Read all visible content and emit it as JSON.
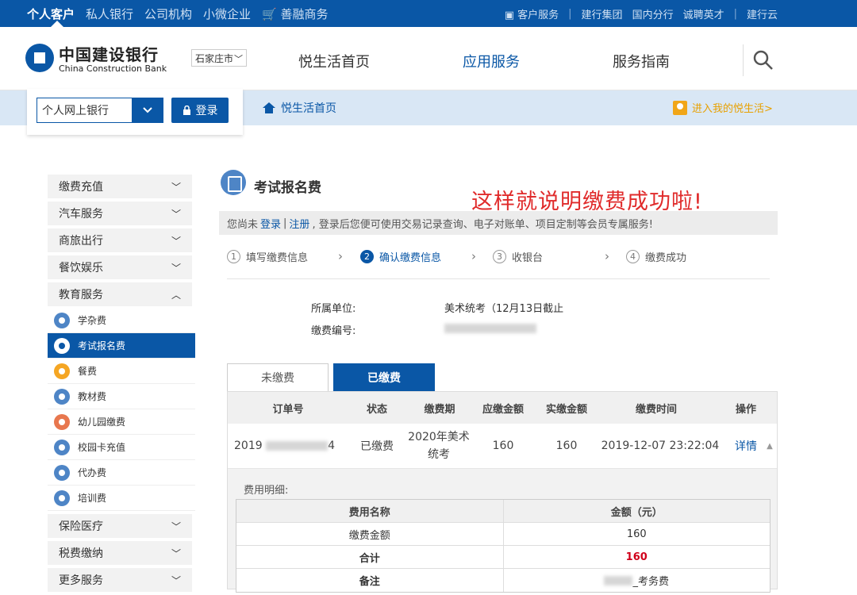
{
  "topbar": {
    "left": [
      "个人客户",
      "私人银行",
      "公司机构",
      "小微企业",
      "善融商务"
    ],
    "right": [
      "客户服务",
      "建行集团",
      "国内分行",
      "诚聘英才",
      "建行云"
    ]
  },
  "header": {
    "logo_cn": "中国建设银行",
    "logo_en": "China Construction Bank",
    "city": "石家庄市",
    "nav": [
      "悦生活首页",
      "应用服务",
      "服务指南"
    ]
  },
  "login": {
    "select_value": "个人网上银行",
    "login_label": "登录"
  },
  "crumb": {
    "home": "悦生活首页",
    "enter": "进入我的悦生活>"
  },
  "sidebar": {
    "cats_top": [
      "缴费充值",
      "汽车服务",
      "商旅出行",
      "餐饮娱乐",
      "教育服务"
    ],
    "subs": [
      "学杂费",
      "考试报名费",
      "餐费",
      "教材费",
      "幼儿园缴费",
      "校园卡充值",
      "代办费",
      "培训费"
    ],
    "cats_bottom": [
      "保险医疗",
      "税费缴纳",
      "更多服务"
    ]
  },
  "main": {
    "title": "考试报名费",
    "annotation": "这样就说明缴费成功啦!",
    "notice_pre": "您尚未",
    "notice_login": "登录",
    "notice_sep": "|",
    "notice_register": "注册",
    "notice_post": ", 登录后您便可使用交易记录查询、电子对账单、项目定制等会员专属服务!",
    "steps": [
      {
        "num": "1",
        "label": "填写缴费信息"
      },
      {
        "num": "2",
        "label": "确认缴费信息"
      },
      {
        "num": "3",
        "label": "收银台"
      },
      {
        "num": "4",
        "label": "缴费成功"
      }
    ],
    "unit_label": "所属单位:",
    "unit_value": "美术统考（12月13日截止",
    "code_label": "缴费编号:",
    "tabs": [
      "未缴费",
      "已缴费"
    ]
  },
  "table": {
    "headers": [
      "订单号",
      "状态",
      "缴费期",
      "应缴金额",
      "实缴金额",
      "缴费时间",
      "操作"
    ],
    "row": {
      "order_prefix": "2019",
      "order_suffix": "4",
      "status": "已缴费",
      "period_line1": "2020年美术",
      "period_line2": "统考",
      "due": "160",
      "paid": "160",
      "time": "2019-12-07 23:22:04",
      "action": "详情"
    },
    "fee_detail_label": "费用明细:",
    "fee_headers": [
      "费用名称",
      "金额（元）"
    ],
    "fee_rows": [
      {
        "name": "缴费金额",
        "value": "160"
      },
      {
        "name": "合计",
        "value": "160"
      },
      {
        "name": "备注",
        "value": "_考务费"
      }
    ]
  }
}
